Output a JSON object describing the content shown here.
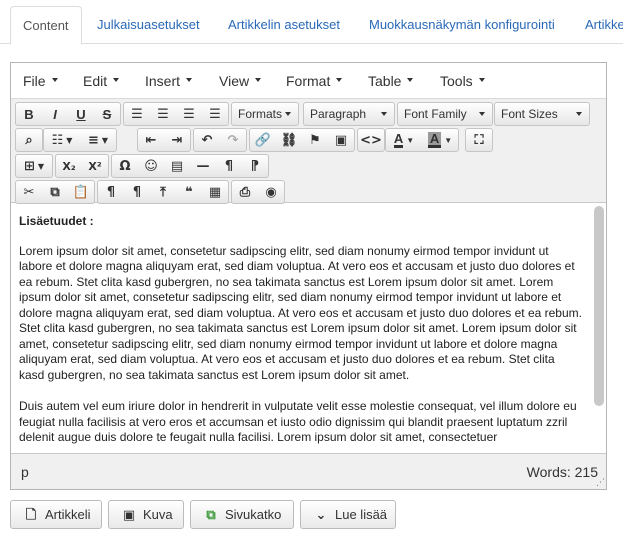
{
  "tabs": [
    {
      "label": "Content",
      "active": true
    },
    {
      "label": "Julkaisuasetukset"
    },
    {
      "label": "Artikkelin asetukset"
    },
    {
      "label": "Muokkausnäkymän konfigurointi"
    },
    {
      "label": "Artikke"
    }
  ],
  "menubar": {
    "file": "File",
    "edit": "Edit",
    "insert": "Insert",
    "view": "View",
    "format": "Format",
    "table": "Table",
    "tools": "Tools"
  },
  "toolbar": {
    "formats": "Formats",
    "paragraph": "Paragraph",
    "font_family": "Font Family",
    "font_sizes": "Font Sizes",
    "glyphs": {
      "bold": "B",
      "italic": "I",
      "underline": "U",
      "strike": "S",
      "align_left": "☰",
      "align_center": "☰",
      "align_right": "☰",
      "justify": "☰",
      "find": "⌕",
      "bullist": "☷",
      "numlist": "≡",
      "outdent": "⇤",
      "indent": "⇥",
      "undo": "↶",
      "redo": "↷",
      "link": "🔗",
      "unlink": "⛓",
      "anchor": "⚑",
      "image": "▣",
      "code": "<>",
      "forecolor": "A",
      "backcolor": "A",
      "fullscreen": "⛶",
      "table": "⊞",
      "subscript": "X₂",
      "superscript": "X²",
      "charmap": "Ω",
      "emoticons": "☺",
      "media": "▤",
      "hr": "—",
      "ltr": "¶",
      "rtl": "¶",
      "cut": "✂",
      "copy": "⧉",
      "paste": "📋",
      "visualchars": "¶",
      "nonbreaking": "¶",
      "pagebreak": "⤒",
      "blockquote": "❝",
      "visualblocks": "▦",
      "print": "⎙",
      "preview": "◉"
    }
  },
  "content": {
    "heading": "Lisäetuudet :",
    "paragraph1": "Lorem ipsum dolor sit amet, consetetur sadipscing elitr, sed diam nonumy eirmod tempor invidunt ut labore et dolore magna aliquyam erat, sed diam voluptua. At vero eos et accusam et justo duo dolores et ea rebum. Stet clita kasd gubergren, no sea takimata sanctus est Lorem ipsum dolor sit amet. Lorem ipsum dolor sit amet, consetetur sadipscing elitr, sed diam nonumy eirmod tempor invidunt ut labore et dolore magna aliquyam erat, sed diam voluptua. At vero eos et accusam et justo duo dolores et ea rebum. Stet clita kasd gubergren, no sea takimata sanctus est Lorem ipsum dolor sit amet. Lorem ipsum dolor sit amet, consetetur sadipscing elitr, sed diam nonumy eirmod tempor invidunt ut labore et dolore magna aliquyam erat, sed diam voluptua. At vero eos et accusam et justo duo dolores et ea rebum. Stet clita kasd gubergren, no sea takimata sanctus est Lorem ipsum dolor sit amet.",
    "paragraph2": "Duis autem vel eum iriure dolor in hendrerit in vulputate velit esse molestie consequat, vel illum dolore eu feugiat nulla facilisis at vero eros et accumsan et iusto odio dignissim qui blandit praesent luptatum zzril delenit augue duis dolore te feugait nulla facilisi. Lorem ipsum dolor sit amet, consectetuer"
  },
  "statusbar": {
    "path": "p",
    "words": "Words: 215"
  },
  "buttons": {
    "article": "Artikkeli",
    "image": "Kuva",
    "pagebreak": "Sivukatko",
    "readmore": "Lue lisää"
  }
}
